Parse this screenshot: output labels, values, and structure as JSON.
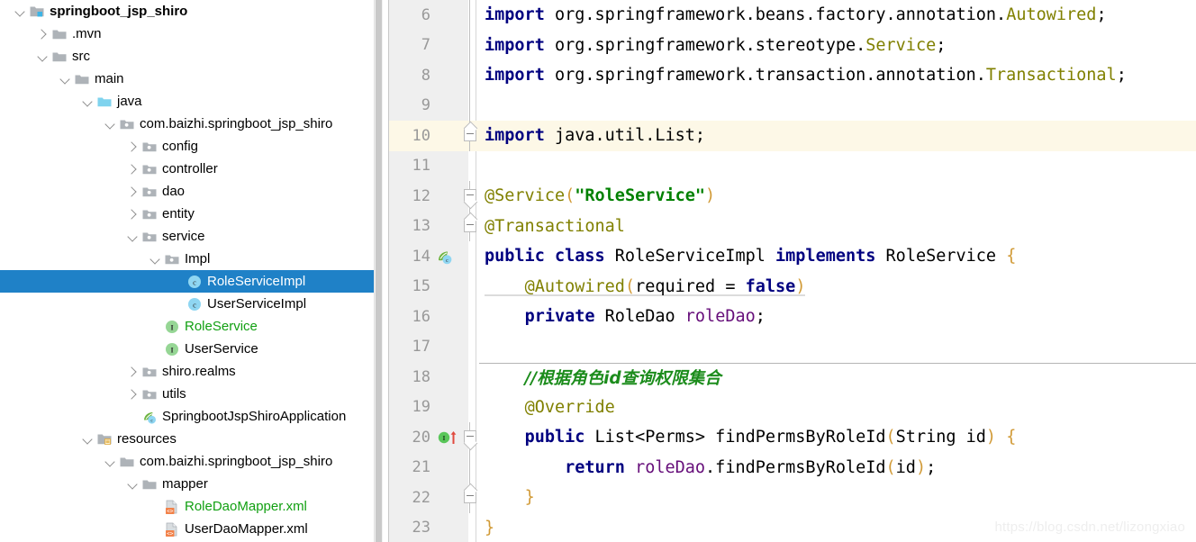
{
  "tree": {
    "rows": [
      {
        "indent": 0,
        "arrow": "expanded",
        "icon": "module-folder-icon",
        "label": "springboot_jsp_shiro",
        "bold": true,
        "selected": false,
        "vcs": "none"
      },
      {
        "indent": 1,
        "arrow": "collapsed",
        "icon": "folder-icon",
        "label": ".mvn",
        "bold": false,
        "selected": false,
        "vcs": "none"
      },
      {
        "indent": 1,
        "arrow": "expanded",
        "icon": "folder-icon",
        "label": "src",
        "bold": false,
        "selected": false,
        "vcs": "none"
      },
      {
        "indent": 2,
        "arrow": "expanded",
        "icon": "folder-icon",
        "label": "main",
        "bold": false,
        "selected": false,
        "vcs": "none"
      },
      {
        "indent": 3,
        "arrow": "expanded",
        "icon": "source-root-folder-icon",
        "label": "java",
        "bold": false,
        "selected": false,
        "vcs": "none"
      },
      {
        "indent": 4,
        "arrow": "expanded",
        "icon": "package-icon",
        "label": "com.baizhi.springboot_jsp_shiro",
        "bold": false,
        "selected": false,
        "vcs": "none"
      },
      {
        "indent": 5,
        "arrow": "collapsed",
        "icon": "package-icon",
        "label": "config",
        "bold": false,
        "selected": false,
        "vcs": "none"
      },
      {
        "indent": 5,
        "arrow": "collapsed",
        "icon": "package-icon",
        "label": "controller",
        "bold": false,
        "selected": false,
        "vcs": "none"
      },
      {
        "indent": 5,
        "arrow": "collapsed",
        "icon": "package-icon",
        "label": "dao",
        "bold": false,
        "selected": false,
        "vcs": "none"
      },
      {
        "indent": 5,
        "arrow": "collapsed",
        "icon": "package-icon",
        "label": "entity",
        "bold": false,
        "selected": false,
        "vcs": "none"
      },
      {
        "indent": 5,
        "arrow": "expanded",
        "icon": "package-icon",
        "label": "service",
        "bold": false,
        "selected": false,
        "vcs": "none"
      },
      {
        "indent": 6,
        "arrow": "expanded",
        "icon": "package-icon",
        "label": "Impl",
        "bold": false,
        "selected": false,
        "vcs": "none"
      },
      {
        "indent": 7,
        "arrow": "none",
        "icon": "java-class-icon",
        "label": "RoleServiceImpl",
        "bold": false,
        "selected": true,
        "vcs": "none"
      },
      {
        "indent": 7,
        "arrow": "none",
        "icon": "java-class-icon",
        "label": "UserServiceImpl",
        "bold": false,
        "selected": false,
        "vcs": "none"
      },
      {
        "indent": 6,
        "arrow": "none",
        "icon": "java-interface-icon",
        "label": "RoleService",
        "bold": false,
        "selected": false,
        "vcs": "modified"
      },
      {
        "indent": 6,
        "arrow": "none",
        "icon": "java-interface-icon",
        "label": "UserService",
        "bold": false,
        "selected": false,
        "vcs": "none"
      },
      {
        "indent": 5,
        "arrow": "collapsed",
        "icon": "package-icon",
        "label": "shiro.realms",
        "bold": false,
        "selected": false,
        "vcs": "none"
      },
      {
        "indent": 5,
        "arrow": "collapsed",
        "icon": "package-icon",
        "label": "utils",
        "bold": false,
        "selected": false,
        "vcs": "none"
      },
      {
        "indent": 5,
        "arrow": "none",
        "icon": "spring-boot-application-icon",
        "label": "SpringbootJspShiroApplication",
        "bold": false,
        "selected": false,
        "vcs": "none"
      },
      {
        "indent": 3,
        "arrow": "expanded",
        "icon": "resource-root-folder-icon",
        "label": "resources",
        "bold": false,
        "selected": false,
        "vcs": "none"
      },
      {
        "indent": 4,
        "arrow": "expanded",
        "icon": "folder-icon",
        "label": "com.baizhi.springboot_jsp_shiro",
        "bold": false,
        "selected": false,
        "vcs": "none"
      },
      {
        "indent": 5,
        "arrow": "expanded",
        "icon": "folder-icon",
        "label": "mapper",
        "bold": false,
        "selected": false,
        "vcs": "none"
      },
      {
        "indent": 6,
        "arrow": "none",
        "icon": "xml-file-icon",
        "label": "RoleDaoMapper.xml",
        "bold": false,
        "selected": false,
        "vcs": "modified"
      },
      {
        "indent": 6,
        "arrow": "none",
        "icon": "xml-file-icon",
        "label": "UserDaoMapper.xml",
        "bold": false,
        "selected": false,
        "vcs": "none"
      }
    ]
  },
  "editor": {
    "lines": [
      {
        "number": "6",
        "caret": false,
        "fold": "line",
        "gutter": "none",
        "tokens": [
          {
            "t": "import",
            "c": "kw"
          },
          {
            "t": " org.springframework.beans.factory.annotation.",
            "c": "pln"
          },
          {
            "t": "Autowired",
            "c": "ann"
          },
          {
            "t": ";",
            "c": "pln"
          }
        ]
      },
      {
        "number": "7",
        "caret": false,
        "fold": "line",
        "gutter": "none",
        "tokens": [
          {
            "t": "import",
            "c": "kw"
          },
          {
            "t": " org.springframework.stereotype.",
            "c": "pln"
          },
          {
            "t": "Service",
            "c": "ann"
          },
          {
            "t": ";",
            "c": "pln"
          }
        ]
      },
      {
        "number": "8",
        "caret": false,
        "fold": "line",
        "gutter": "none",
        "tokens": [
          {
            "t": "import",
            "c": "kw"
          },
          {
            "t": " org.springframework.transaction.annotation.",
            "c": "pln"
          },
          {
            "t": "Transactional",
            "c": "ann"
          },
          {
            "t": ";",
            "c": "pln"
          }
        ]
      },
      {
        "number": "9",
        "caret": false,
        "fold": "line",
        "gutter": "none",
        "tokens": []
      },
      {
        "number": "10",
        "caret": true,
        "fold": "box-up",
        "gutter": "none",
        "tokens": [
          {
            "t": "import",
            "c": "kw"
          },
          {
            "t": " java.util.List;",
            "c": "pln"
          }
        ]
      },
      {
        "number": "11",
        "caret": false,
        "fold": "none",
        "gutter": "none",
        "tokens": []
      },
      {
        "number": "12",
        "caret": false,
        "fold": "box-down",
        "gutter": "none",
        "tokens": [
          {
            "t": "@Service",
            "c": "ann"
          },
          {
            "t": "(",
            "c": "brc"
          },
          {
            "t": "\"RoleService\"",
            "c": "str"
          },
          {
            "t": ")",
            "c": "brc"
          }
        ]
      },
      {
        "number": "13",
        "caret": false,
        "fold": "box-up",
        "gutter": "none",
        "tokens": [
          {
            "t": "@Transactional",
            "c": "ann"
          }
        ]
      },
      {
        "number": "14",
        "caret": false,
        "fold": "none",
        "gutter": "spring-bean-icon",
        "tokens": [
          {
            "t": "public class",
            "c": "kw"
          },
          {
            "t": " RoleServiceImpl ",
            "c": "pln"
          },
          {
            "t": "implements",
            "c": "kw"
          },
          {
            "t": " RoleService ",
            "c": "pln"
          },
          {
            "t": "{",
            "c": "brc"
          }
        ]
      },
      {
        "number": "15",
        "caret": false,
        "fold": "none",
        "gutter": "none",
        "warn": true,
        "tokens": [
          {
            "t": "    ",
            "c": "pln"
          },
          {
            "t": "@Autowired",
            "c": "ann"
          },
          {
            "t": "(",
            "c": "brc"
          },
          {
            "t": "required = ",
            "c": "pln"
          },
          {
            "t": "false",
            "c": "kw"
          },
          {
            "t": ")",
            "c": "brc"
          }
        ]
      },
      {
        "number": "16",
        "caret": false,
        "fold": "none",
        "gutter": "none",
        "tokens": [
          {
            "t": "    ",
            "c": "pln"
          },
          {
            "t": "private",
            "c": "kw"
          },
          {
            "t": " RoleDao ",
            "c": "pln"
          },
          {
            "t": "roleDao",
            "c": "fld"
          },
          {
            "t": ";",
            "c": "pln"
          }
        ]
      },
      {
        "number": "17",
        "caret": false,
        "fold": "none",
        "gutter": "none",
        "tokens": []
      },
      {
        "number": "18",
        "caret": false,
        "fold": "none",
        "gutter": "none",
        "sepabove": true,
        "tokens": [
          {
            "t": "    ",
            "c": "pln"
          },
          {
            "t": "//根据角色id查询权限集合",
            "c": "cmt"
          }
        ]
      },
      {
        "number": "19",
        "caret": false,
        "fold": "none",
        "gutter": "none",
        "tokens": [
          {
            "t": "    ",
            "c": "pln"
          },
          {
            "t": "@Override",
            "c": "ann"
          }
        ]
      },
      {
        "number": "20",
        "caret": false,
        "fold": "box-down",
        "gutter": "implementing-method-icon",
        "tokens": [
          {
            "t": "    ",
            "c": "pln"
          },
          {
            "t": "public",
            "c": "kw"
          },
          {
            "t": " List<Perms> findPermsByRoleId",
            "c": "pln"
          },
          {
            "t": "(",
            "c": "brc"
          },
          {
            "t": "String id",
            "c": "pln"
          },
          {
            "t": ")",
            "c": "brc"
          },
          {
            "t": " ",
            "c": "pln"
          },
          {
            "t": "{",
            "c": "brc"
          }
        ]
      },
      {
        "number": "21",
        "caret": false,
        "fold": "line",
        "gutter": "none",
        "tokens": [
          {
            "t": "        ",
            "c": "pln"
          },
          {
            "t": "return",
            "c": "kw"
          },
          {
            "t": " ",
            "c": "pln"
          },
          {
            "t": "roleDao",
            "c": "fld"
          },
          {
            "t": ".findPermsByRoleId",
            "c": "pln"
          },
          {
            "t": "(",
            "c": "brc"
          },
          {
            "t": "id",
            "c": "pln"
          },
          {
            "t": ")",
            "c": "brc"
          },
          {
            "t": ";",
            "c": "pln"
          }
        ]
      },
      {
        "number": "22",
        "caret": false,
        "fold": "box-up",
        "gutter": "none",
        "tokens": [
          {
            "t": "    ",
            "c": "pln"
          },
          {
            "t": "}",
            "c": "brc"
          }
        ]
      },
      {
        "number": "23",
        "caret": false,
        "fold": "none",
        "gutter": "none",
        "tokens": [
          {
            "t": "}",
            "c": "brc"
          }
        ]
      }
    ]
  },
  "watermark": {
    "text": "https://blog.csdn.net/lizongxiao"
  },
  "colors": {
    "selection": "#1f81c7",
    "caret_line": "#fdf8e7",
    "gutter_bg": "#efefef",
    "keyword": "#000080",
    "annotation": "#808000",
    "string": "#008000",
    "field": "#660e7a",
    "comment": "#1c8c1c",
    "brace": "#d19a36",
    "vcs_modified": "#12a012"
  }
}
